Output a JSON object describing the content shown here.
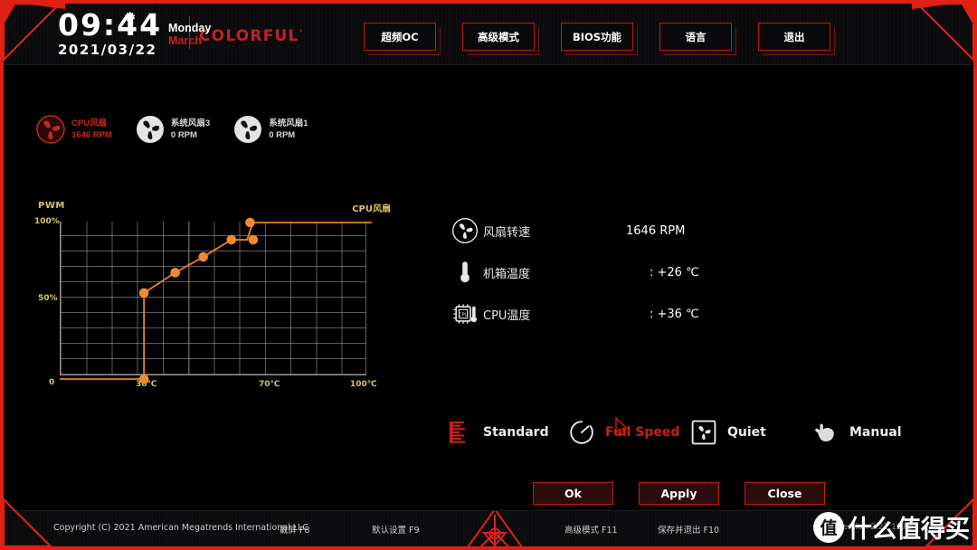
{
  "header": {
    "time": "09:44",
    "date": "2021/03/22",
    "day_of_week": "Monday",
    "month": "March",
    "brand": "COLORFUL",
    "brand_sup": "°",
    "gear_icon": "gear-icon",
    "nav": [
      {
        "label": "超频OC"
      },
      {
        "label": "高级模式"
      },
      {
        "label": "BIOS功能"
      },
      {
        "label": "语言"
      },
      {
        "label": "退出"
      }
    ]
  },
  "fan_chips": [
    {
      "name": "CPU风扇",
      "rpm": "1646 RPM",
      "state": "active",
      "icon": "fan-icon"
    },
    {
      "name": "系统风扇3",
      "rpm": "0 RPM",
      "state": "idle",
      "icon": "fan-icon"
    },
    {
      "name": "系统风扇1",
      "rpm": "0 RPM",
      "state": "idle",
      "icon": "fan-icon"
    }
  ],
  "chart_data": {
    "type": "line",
    "title": "CPU风扇",
    "ylabel": "PWM",
    "xlabel": "",
    "xlim": [
      0,
      100
    ],
    "ylim": [
      0,
      100
    ],
    "xticks": [
      "0",
      "30℃",
      "70℃",
      "100℃"
    ],
    "xtick_values": [
      0,
      30,
      70,
      100
    ],
    "yticks": [
      "0",
      "50%",
      "100%"
    ],
    "ytick_values": [
      0,
      50,
      100
    ],
    "grid": true,
    "legend_position": "top-right",
    "x": [
      0,
      27,
      27,
      37,
      46,
      55,
      60,
      62,
      62,
      100
    ],
    "y": [
      0,
      0,
      55,
      68,
      78,
      89,
      89,
      100,
      100,
      100
    ],
    "points": [
      {
        "temp": 27,
        "pwm": 0
      },
      {
        "temp": 27,
        "pwm": 55
      },
      {
        "temp": 37,
        "pwm": 68
      },
      {
        "temp": 46,
        "pwm": 78
      },
      {
        "temp": 55,
        "pwm": 89
      },
      {
        "temp": 62,
        "pwm": 89
      },
      {
        "temp": 61,
        "pwm": 100
      }
    ],
    "line_color": "#e8812c",
    "point_color": "#f08a2c",
    "axis_label_color": "#d8c46a"
  },
  "info_rows": [
    {
      "icon": "fan-icon",
      "label": "风扇转速",
      "value": "1646 RPM"
    },
    {
      "icon": "thermometer-icon",
      "label": "机箱温度",
      "value": ": +26 ℃"
    },
    {
      "icon": "cpu-chip-icon",
      "label": "CPU温度",
      "value": ": +36 ℃"
    }
  ],
  "modes": [
    {
      "label": "Standard",
      "icon": "equalizer-icon",
      "selected": false
    },
    {
      "label": "Full Speed",
      "icon": "gauge-icon",
      "selected": true
    },
    {
      "label": "Quiet",
      "icon": "fan-square-icon",
      "selected": false
    },
    {
      "label": "Manual",
      "icon": "hand-pointer-icon",
      "selected": false
    }
  ],
  "actions": [
    {
      "label": "Ok"
    },
    {
      "label": "Apply"
    },
    {
      "label": "Close"
    }
  ],
  "footer": {
    "copyright": "Copyright (C) 2021 American Megatrends International LLC",
    "keys": [
      {
        "label": "截屏  F8"
      },
      {
        "label": "默认设置  F9"
      },
      {
        "label": "高级模式  F11"
      },
      {
        "label": "保存并退出  F10"
      }
    ],
    "version": "Version 2.21.1278",
    "emblem": "triangle-star-emblem"
  },
  "watermark": {
    "badge": "值",
    "text": "什么值得买"
  },
  "colors": {
    "accent_red": "#c01a12",
    "frame_red": "#e02014",
    "curve_orange": "#e8812c",
    "axis_gold": "#d8c46a"
  }
}
